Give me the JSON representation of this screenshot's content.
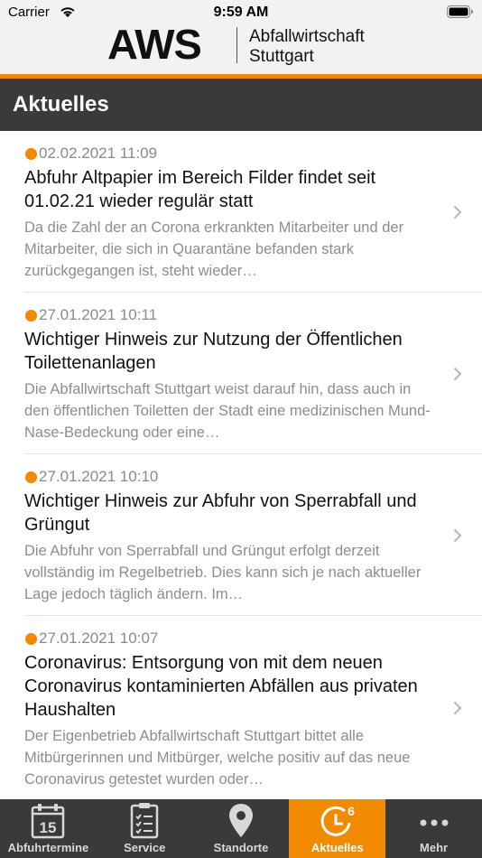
{
  "status": {
    "carrier": "Carrier",
    "time": "9:59 AM"
  },
  "header": {
    "logo_text": "AWS",
    "logo_line1": "Abfallwirtschaft",
    "logo_line2": "Stuttgart"
  },
  "nav": {
    "title": "Aktuelles"
  },
  "news": [
    {
      "date": "02.02.2021 11:09",
      "title": "Abfuhr Altpapier im Bereich Filder findet seit 01.02.21 wieder regulär statt",
      "excerpt": "Da die Zahl der an Corona erkrankten Mitarbeiter und der Mitarbeiter, die sich in Quarantäne befanden stark zurückgegangen ist, steht wieder…"
    },
    {
      "date": "27.01.2021 10:11",
      "title": "Wichtiger Hinweis zur Nutzung der Öffentlichen Toilettenanlagen",
      "excerpt": "Die Abfallwirtschaft Stuttgart weist darauf hin, dass auch in den öffentlichen Toiletten der Stadt eine medizinischen Mund-Nase-Bedeckung oder eine…"
    },
    {
      "date": "27.01.2021 10:10",
      "title": "Wichtiger Hinweis zur Abfuhr von Sperrabfall und Grüngut",
      "excerpt": "Die Abfuhr von Sperrabfall und Grüngut erfolgt derzeit vollständig im Regelbetrieb. Dies kann sich je nach aktueller Lage jedoch täglich ändern. Im…"
    },
    {
      "date": "27.01.2021 10:07",
      "title": "Coronavirus: Entsorgung von mit dem neuen Coronavirus kontaminierten Abfällen aus privaten Haushalten",
      "excerpt": "Der Eigenbetrieb Abfallwirtschaft Stuttgart bittet alle Mitbürgerinnen und Mitbürger, welche positiv auf das neue Coronavirus getestet wurden oder…"
    }
  ],
  "tabs": [
    {
      "label": "Abfuhrtermine",
      "icon": "calendar-icon",
      "calendar_day": "15"
    },
    {
      "label": "Service",
      "icon": "checklist-icon"
    },
    {
      "label": "Standorte",
      "icon": "location-pin-icon"
    },
    {
      "label": "Aktuelles",
      "icon": "clock-icon",
      "badge": "6",
      "active": true
    },
    {
      "label": "Mehr",
      "icon": "more-dots-icon"
    }
  ],
  "colors": {
    "accent": "#f28a00",
    "bar_dark": "#3a3a3a"
  }
}
